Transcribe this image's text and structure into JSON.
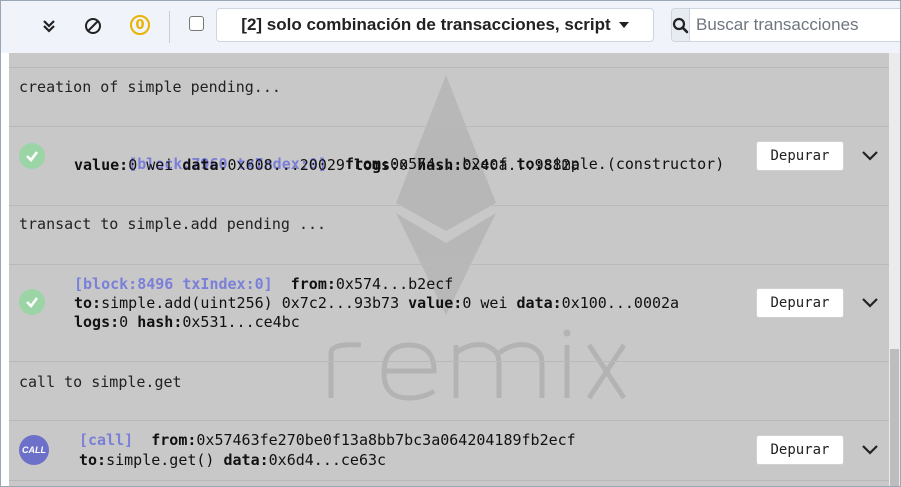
{
  "toolbar": {
    "pending_count": "0",
    "filter_select": "[2] solo combinación de transacciones, script",
    "search_placeholder": "Buscar transacciones"
  },
  "watermark_text": "remix",
  "logs": [
    {
      "text": "creation of simple pending..."
    },
    {
      "text": "transact to simple.add pending ..."
    },
    {
      "text": "call to simple.get"
    }
  ],
  "txs": [
    {
      "tag": "[block:7960 txIndex:0]",
      "line1": [
        [
          "from:",
          "0x574...b2ecf"
        ],
        [
          "to:",
          "simple.(constructor)"
        ]
      ],
      "line2": [
        [
          "value:",
          "0 wei"
        ],
        [
          "data:",
          "0x608...20029"
        ],
        [
          "logs:",
          "0"
        ],
        [
          "hash:",
          "0x40a...9882a"
        ]
      ],
      "line3": [],
      "debug_label": "Depurar"
    },
    {
      "tag": "[block:8496 txIndex:0]",
      "line1": [
        [
          "from:",
          "0x574...b2ecf"
        ]
      ],
      "line2": [
        [
          "to:",
          "simple.add(uint256) 0x7c2...93b73"
        ],
        [
          "value:",
          "0 wei"
        ],
        [
          "data:",
          "0x100...0002a"
        ]
      ],
      "line3": [
        [
          "logs:",
          "0"
        ],
        [
          "hash:",
          "0x531...ce4bc"
        ]
      ],
      "debug_label": "Depurar"
    },
    {
      "tag": "[call]",
      "line1": [
        [
          "from:",
          "0x57463fe270be0f13a8bb7bc3a064204189fb2ecf"
        ]
      ],
      "line2": [
        [
          "to:",
          "simple.get()"
        ],
        [
          "data:",
          "0x6d4...ce63c"
        ]
      ],
      "line3": [],
      "debug_label": "Depurar",
      "icon_label": "CALL"
    }
  ]
}
